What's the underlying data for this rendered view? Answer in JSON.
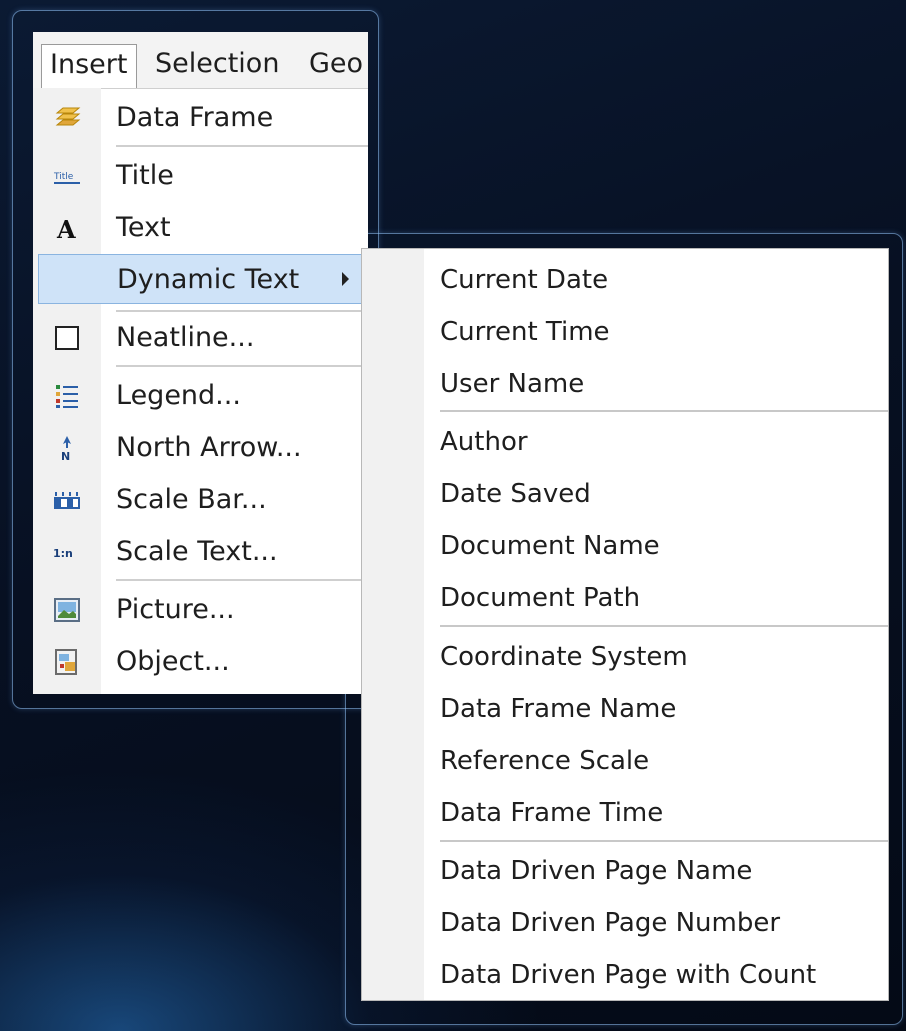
{
  "menubar": {
    "insert": "Insert",
    "selection": "Selection",
    "geo": "Geo"
  },
  "insert_menu": {
    "items": [
      {
        "label": "Data Frame",
        "icon": "data-frame-icon"
      },
      {
        "label": "Title",
        "icon": "title-icon",
        "icon_text": "Title"
      },
      {
        "label": "Text",
        "icon": "text-icon",
        "icon_text": "A"
      },
      {
        "label": "Dynamic Text",
        "icon": "none"
      },
      {
        "label": "Neatline...",
        "icon": "neatline-icon"
      },
      {
        "label": "Legend...",
        "icon": "legend-icon"
      },
      {
        "label": "North Arrow...",
        "icon": "north-arrow-icon",
        "icon_text": "N"
      },
      {
        "label": "Scale Bar...",
        "icon": "scale-bar-icon"
      },
      {
        "label": "Scale Text...",
        "icon": "scale-text-icon",
        "icon_text": "1:n"
      },
      {
        "label": "Picture...",
        "icon": "picture-icon"
      },
      {
        "label": "Object...",
        "icon": "object-icon"
      }
    ]
  },
  "dynamic_text_submenu": {
    "items": [
      "Current Date",
      "Current Time",
      "User Name",
      "Author",
      "Date Saved",
      "Document Name",
      "Document Path",
      "Coordinate System",
      "Data Frame Name",
      "Reference Scale",
      "Data Frame Time",
      "Data Driven Page Name",
      "Data Driven Page Number",
      "Data Driven Page with Count"
    ]
  },
  "colors": {
    "highlight": "#cfe3f8",
    "highlight_border": "#8ab4e0",
    "menu_bg": "#ffffff",
    "gutter": "#f1f1f1",
    "background": "#071022"
  }
}
